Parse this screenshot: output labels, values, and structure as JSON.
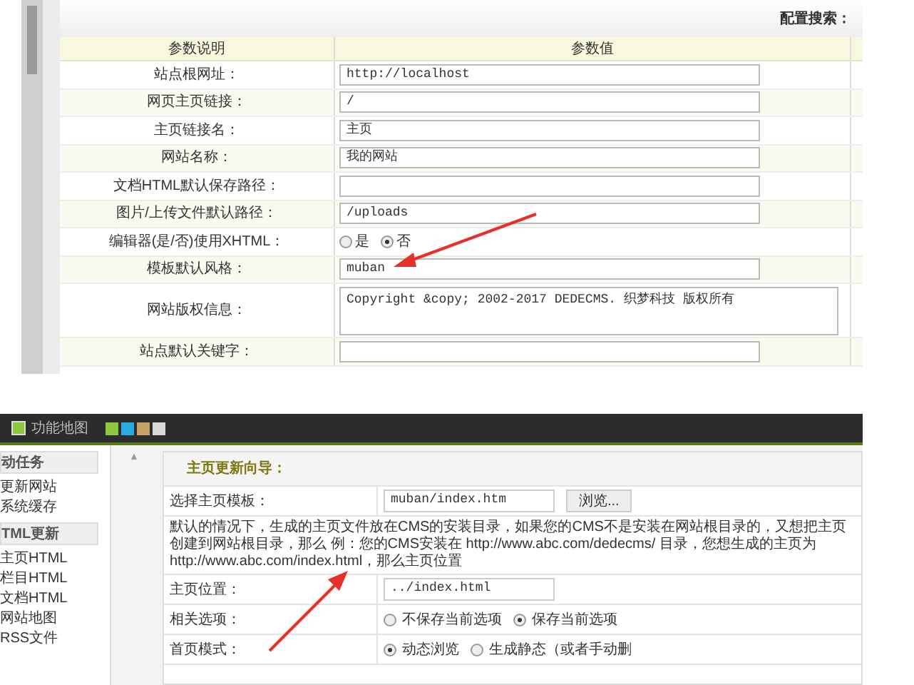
{
  "top_panel": {
    "search_label": "配置搜索：",
    "columns": [
      "参数说明",
      "参数值"
    ],
    "rows": [
      {
        "kind": "text",
        "label": "站点根网址：",
        "value": "http://localhost"
      },
      {
        "kind": "text",
        "label": "网页主页链接：",
        "value": "/"
      },
      {
        "kind": "text",
        "label": "主页链接名：",
        "value": "主页"
      },
      {
        "kind": "text",
        "label": "网站名称：",
        "value": "我的网站"
      },
      {
        "kind": "text",
        "label": "文档HTML默认保存路径：",
        "value": ""
      },
      {
        "kind": "text",
        "label": "图片/上传文件默认路径：",
        "value": "/uploads"
      },
      {
        "kind": "radio",
        "label": "编辑器(是/否)使用XHTML：",
        "options": [
          {
            "label": "是",
            "selected": false
          },
          {
            "label": "否",
            "selected": true
          }
        ]
      },
      {
        "kind": "text",
        "label": "模板默认风格：",
        "value": "muban"
      },
      {
        "kind": "textarea",
        "label": "网站版权信息：",
        "value": "Copyright &copy; 2002-2017 DEDECMS. 织梦科技 版权所有"
      },
      {
        "kind": "text",
        "label": "站点默认关键字：",
        "value": ""
      }
    ]
  },
  "bottom_panel": {
    "toolbar_title": "功能地图",
    "scroll_up": "▲",
    "swatches": [
      {
        "color": "#8dc63f"
      },
      {
        "color": "#29abe2"
      },
      {
        "color": "#c8a165"
      },
      {
        "color": "#d8d8d8"
      }
    ],
    "sidebar": [
      {
        "title": "动任务",
        "items": [
          "更新网站",
          "系统缓存"
        ]
      },
      {
        "title": "TML更新",
        "items": [
          "主页HTML",
          "栏目HTML",
          "文档HTML",
          "网站地图",
          "RSS文件"
        ]
      }
    ],
    "form": {
      "title": "主页更新向导：",
      "rows": [
        {
          "kind": "file",
          "label": "选择主页模板：",
          "value": "muban/index.htm",
          "button": "浏览..."
        },
        {
          "kind": "note",
          "text": "默认的情况下，生成的主页文件放在CMS的安装目录，如果您的CMS不是安装在网站根目录的，又想把主页创建到网站根目录，那么 例：您的CMS安装在 http://www.abc.com/dedecms/ 目录，您想生成的主页为 http://www.abc.com/index.html，那么主页位置"
        },
        {
          "kind": "text",
          "label": "主页位置：",
          "value": "../index.html"
        },
        {
          "kind": "radio",
          "label": "相关选项：",
          "options": [
            {
              "label": "不保存当前选项",
              "selected": false
            },
            {
              "label": "保存当前选项",
              "selected": true
            }
          ]
        },
        {
          "kind": "radio",
          "label": "首页模式：",
          "options": [
            {
              "label": "动态浏览",
              "selected": true
            },
            {
              "label": "生成静态（或者手动删",
              "selected": false
            }
          ]
        }
      ]
    }
  }
}
